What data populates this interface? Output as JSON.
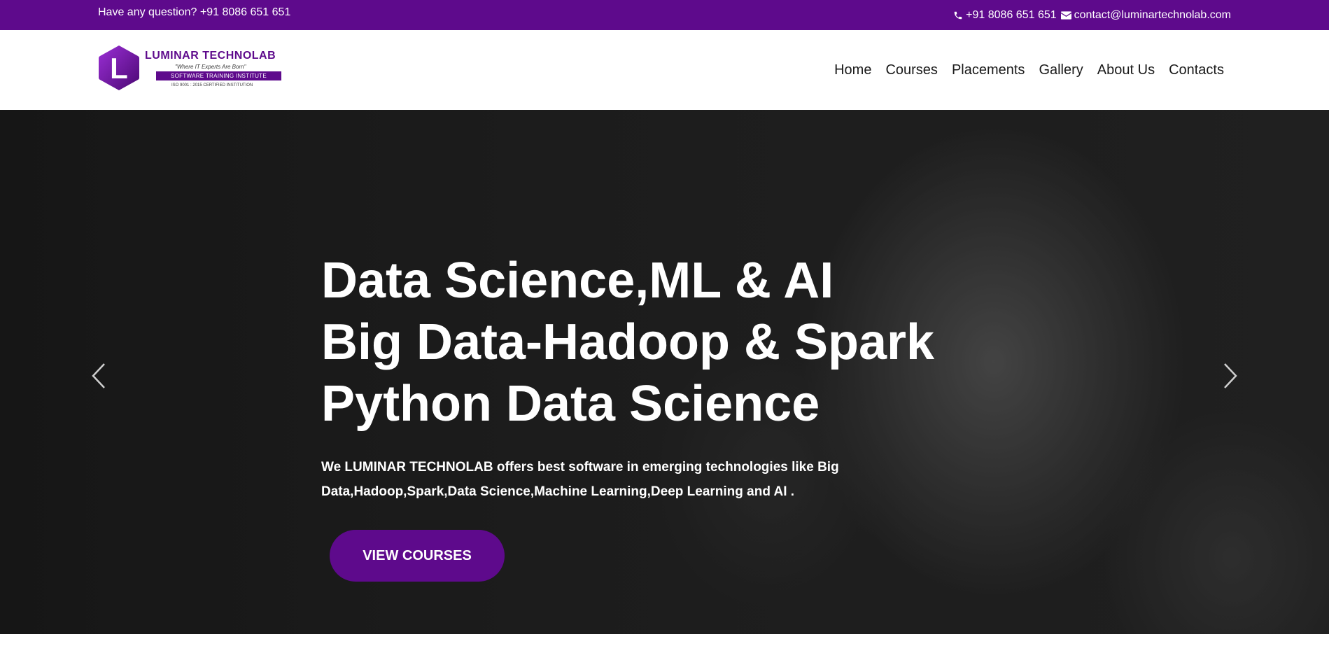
{
  "topbar": {
    "question": "Have any question? +91 8086 651 651",
    "phone": "+91 8086 651 651",
    "email": "contact@luminartechnolab.com",
    "background": "#5e0a8c"
  },
  "logo": {
    "name": "LUMINAR TECHNOLAB",
    "tagline": "\"Where IT Experts Are Born\"",
    "institute": "SOFTWARE TRAINING INSTITUTE",
    "iso": "ISO 9001 : 2015 CERTIFIED INSTITUTION",
    "letter": "L"
  },
  "nav": {
    "items": [
      {
        "label": "Home"
      },
      {
        "label": "Courses"
      },
      {
        "label": "Placements"
      },
      {
        "label": "Gallery"
      },
      {
        "label": "About Us"
      },
      {
        "label": "Contacts"
      }
    ]
  },
  "hero": {
    "lines": [
      "Data Science,ML & AI",
      "Big Data-Hadoop & Spark",
      "Python Data Science"
    ],
    "description": "We LUMINAR TECHNOLAB offers best software in emerging technologies like Big Data,Hadoop,Spark,Data Science,Machine Learning,Deep Learning and AI .",
    "button_label": "VIEW COURSES",
    "accent": "#5e0a8c"
  },
  "icons": {
    "phone": "phone-icon",
    "email": "envelope-icon",
    "prev": "chevron-left-icon",
    "next": "chevron-right-icon"
  }
}
